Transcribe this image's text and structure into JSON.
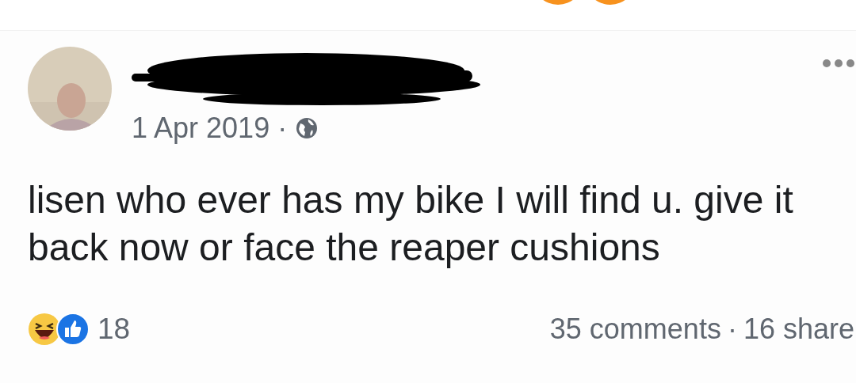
{
  "post": {
    "author": {
      "name_redacted": true
    },
    "date": "1 Apr 2019",
    "date_separator": "·",
    "audience": {
      "kind": "public"
    },
    "text": "lisen who ever has my bike I will find u. give it back now or face the reaper cushions",
    "reactions": {
      "types": [
        {
          "kind": "haha"
        },
        {
          "kind": "like"
        }
      ],
      "count": "18"
    },
    "comments": "35 comments",
    "footer_separator": "·",
    "shares": "16 share"
  }
}
